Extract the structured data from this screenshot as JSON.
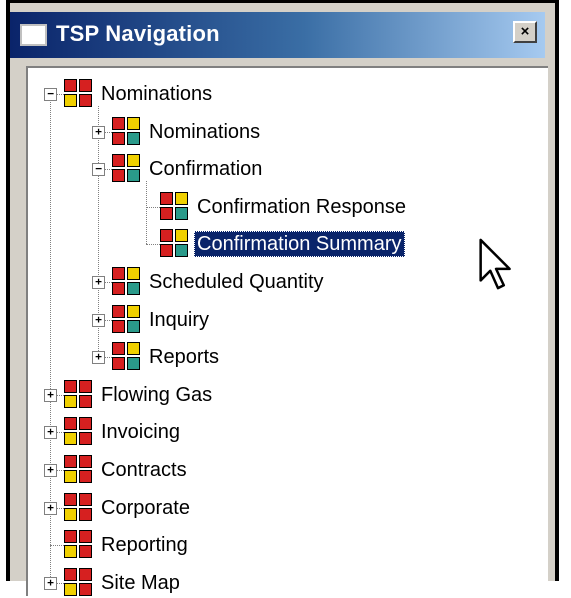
{
  "window": {
    "title": "TSP Navigation",
    "close_label": "×"
  },
  "tree": [
    {
      "label": "Nominations",
      "level": 0,
      "expander": "−",
      "row": 0
    },
    {
      "label": "Nominations",
      "level": 1,
      "expander": "+",
      "row": 1
    },
    {
      "label": "Confirmation",
      "level": 1,
      "expander": "−",
      "row": 2
    },
    {
      "label": "Confirmation Response",
      "level": 2,
      "expander": "",
      "row": 3
    },
    {
      "label": "Confirmation Summary",
      "level": 2,
      "expander": "",
      "row": 4,
      "selected": true
    },
    {
      "label": "Scheduled Quantity",
      "level": 1,
      "expander": "+",
      "row": 5
    },
    {
      "label": "Inquiry",
      "level": 1,
      "expander": "+",
      "row": 6
    },
    {
      "label": "Reports",
      "level": 1,
      "expander": "+",
      "row": 7
    },
    {
      "label": "Flowing Gas",
      "level": 0,
      "expander": "+",
      "row": 8
    },
    {
      "label": "Invoicing",
      "level": 0,
      "expander": "+",
      "row": 9
    },
    {
      "label": "Contracts",
      "level": 0,
      "expander": "+",
      "row": 10
    },
    {
      "label": "Corporate",
      "level": 0,
      "expander": "+",
      "row": 11
    },
    {
      "label": "Reporting",
      "level": 0,
      "expander": "",
      "row": 12
    },
    {
      "label": "Site Map",
      "level": 0,
      "expander": "+",
      "row": 13
    }
  ],
  "colors": {
    "title_dark": "#0a246a",
    "title_light": "#a6caf0",
    "selection": "#0a246a",
    "icon_red": "#d62020",
    "icon_yellow": "#f0d000",
    "icon_teal": "#2a9a8a",
    "icon_gray": "#8a8a8a"
  }
}
